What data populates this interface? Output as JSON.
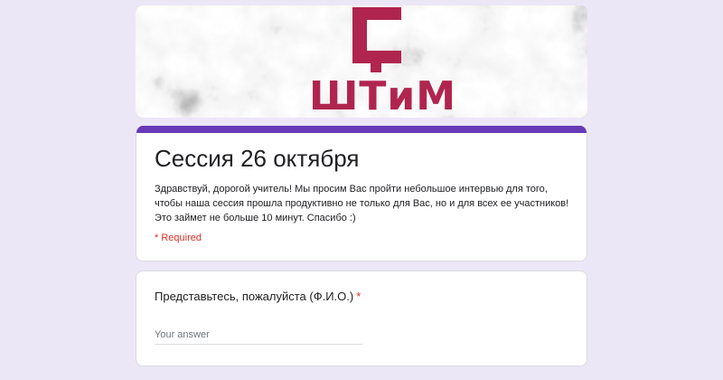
{
  "banner": {
    "logo_text": "ШТиМ",
    "logo_mark": "Ç",
    "brand_color": "#b0254f"
  },
  "form": {
    "accent_color": "#673ab7",
    "title": "Сессия 26 октября",
    "description": "Здравствуй, дорогой учитель! Мы просим Вас пройти небольшое интервью для того, чтобы наша сессия прошла продуктивно не только для Вас, но и для всех ее участников! Это займет не больше 10 минут. Спасибо :)",
    "required_note": "* Required"
  },
  "questions": [
    {
      "label": "Представьтесь, пожалуйста (Ф.И.О.)",
      "required_mark": "*",
      "placeholder": "Your answer",
      "value": ""
    }
  ]
}
